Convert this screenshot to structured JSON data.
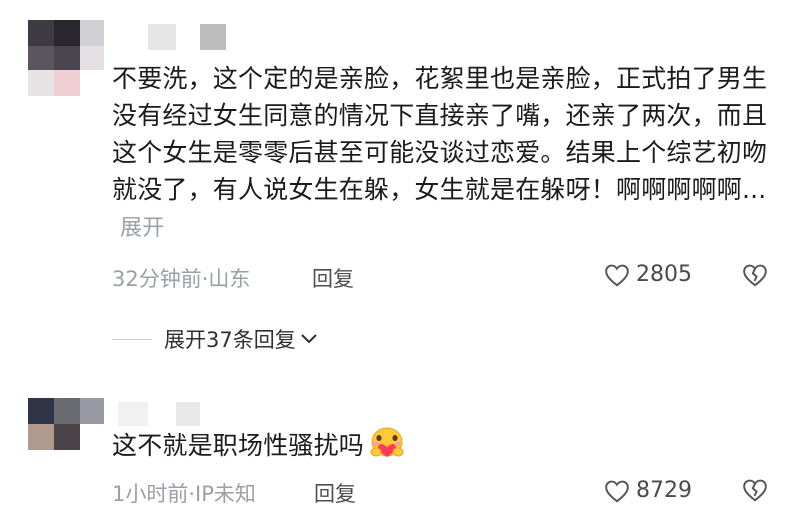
{
  "comments": [
    {
      "text": "不要洗，这个定的是亲脸，花絮里也是亲脸，正式拍了男生没有经过女生同意的情况下直接亲了嘴，还亲了两次，而且这个女生是零零后甚至可能没谈过恋爱。结果上个综艺初吻就没了，有人说女生在躲，女生就是在躲呀！啊啊啊啊啊...",
      "expand_label": "展开",
      "time_location": "32分钟前·山东",
      "reply_label": "回复",
      "likes": "2805"
    },
    {
      "text": "这不就是职场性骚扰吗",
      "emoji": "hugging-face-with-heart",
      "time_location": "1小时前·IP未知",
      "reply_label": "回复",
      "likes": "8729"
    }
  ],
  "expand_replies_label": "展开37条回复",
  "icons": {
    "like": "heart-outline-icon",
    "dislike": "broken-heart-icon",
    "expand": "chevron-down-icon"
  },
  "colors": {
    "text": "#1b1b1b",
    "meta": "#9aa0a6",
    "reply": "#4f4f4f"
  }
}
